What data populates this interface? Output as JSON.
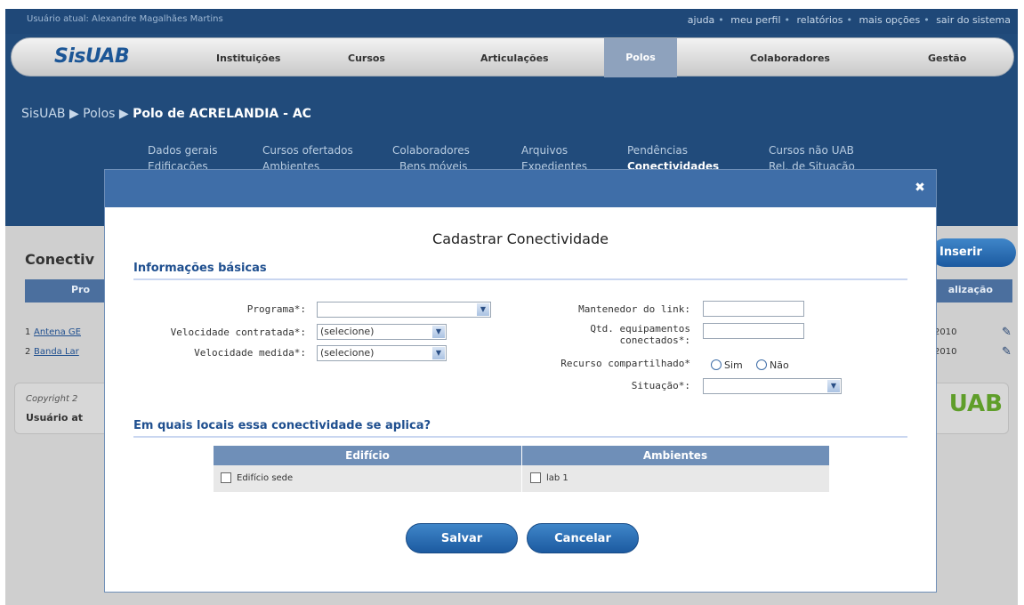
{
  "top": {
    "user_line": "Usuário atual: Alexandre Magalhães Martins",
    "links": [
      "ajuda",
      "meu perfil",
      "relatórios",
      "mais opções",
      "sair do sistema"
    ]
  },
  "nav": {
    "logo": "SisUAB",
    "items": [
      "Instituições",
      "Cursos",
      "Articulações",
      "Polos",
      "Colaboradores",
      "Gestão"
    ]
  },
  "breadcrumb": {
    "part1": "SisUAB",
    "part2": "Polos",
    "current": "Polo de ACRELANDIA - AC"
  },
  "subnav": {
    "row1": [
      "Dados gerais",
      "Cursos ofertados",
      "Colaboradores",
      "Arquivos",
      "Pendências",
      "Cursos não UAB"
    ],
    "row2": [
      "Edificações",
      "Ambientes",
      "Bens móveis",
      "Expedientes",
      "Conectividades",
      "Rel. de Situação"
    ]
  },
  "background": {
    "title": "Conectiv",
    "insert_button": "Inserir",
    "table_head_program": "Pro",
    "table_head_update": "alização",
    "rows": [
      {
        "num": "1",
        "name": "Antena GE",
        "date": "2010"
      },
      {
        "num": "2",
        "name": "Banda Lar",
        "date": "2010"
      }
    ],
    "copyright": "Copyright 2",
    "footer_user": "Usuário at",
    "footer_logo": "UAB"
  },
  "modal": {
    "close_symbol": "✖",
    "title": "Cadastrar Conectividade",
    "section_basic": "Informações básicas",
    "programa_label": "Programa*:",
    "programa_value": "",
    "vel_contratada_label": "Velocidade contratada*:",
    "vel_contratada_value": "(selecione)",
    "vel_medida_label": "Velocidade medida*:",
    "vel_medida_value": "(selecione)",
    "mantenedor_label": "Mantenedor do link:",
    "mantenedor_value": "",
    "qtd_label_1": "Qtd. equipamentos",
    "qtd_label_2": "conectados*:",
    "qtd_value": "",
    "recurso_label": "Recurso compartilhado*",
    "radio_sim": "Sim",
    "radio_nao": "Não",
    "situacao_label": "Situação*:",
    "situacao_value": "",
    "section_locais": "Em quais locais essa conectividade se aplica?",
    "col_edificio": "Edifício",
    "col_ambientes": "Ambientes",
    "edificio_item": "Edifício sede",
    "ambiente_item": "lab 1",
    "save_label": "Salvar",
    "cancel_label": "Cancelar"
  },
  "colors": {
    "header_blue": "#214b7b",
    "accent_blue": "#1c5aa0",
    "table_head": "#6f8fb8",
    "logo_green": "#5f9e2a"
  }
}
